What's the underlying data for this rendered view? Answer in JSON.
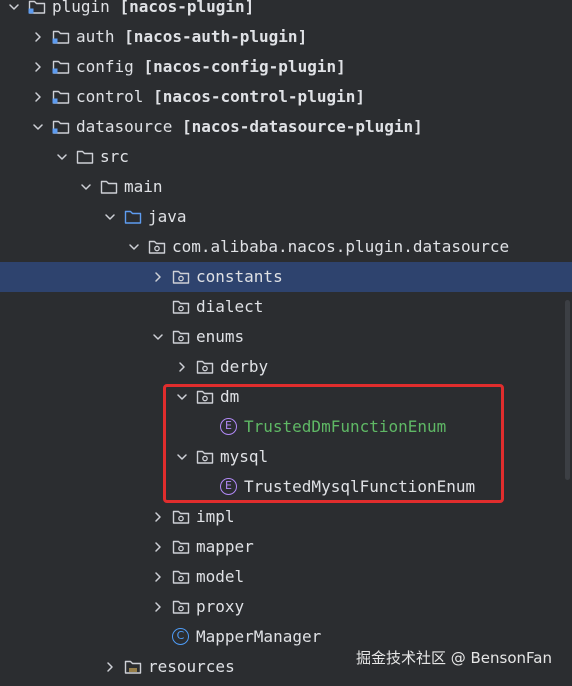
{
  "tree": [
    {
      "label": "plugin [nacos-plugin]",
      "type": "module",
      "expanded": true,
      "depth": 0
    },
    {
      "label": "auth [nacos-auth-plugin]",
      "type": "module",
      "expanded": false,
      "depth": 1
    },
    {
      "label": "config [nacos-config-plugin]",
      "type": "module",
      "expanded": false,
      "depth": 1
    },
    {
      "label": "control [nacos-control-plugin]",
      "type": "module",
      "expanded": false,
      "depth": 1
    },
    {
      "label": "datasource [nacos-datasource-plugin]",
      "type": "module",
      "expanded": true,
      "depth": 1
    },
    {
      "label": "src",
      "type": "folder",
      "expanded": true,
      "depth": 2
    },
    {
      "label": "main",
      "type": "folder",
      "expanded": true,
      "depth": 3
    },
    {
      "label": "java",
      "type": "source-folder",
      "expanded": true,
      "depth": 4
    },
    {
      "label": "com.alibaba.nacos.plugin.datasource",
      "type": "package",
      "expanded": true,
      "depth": 5
    },
    {
      "label": "constants",
      "type": "package",
      "expanded": false,
      "depth": 6,
      "selected": true
    },
    {
      "label": "dialect",
      "type": "package",
      "expanded": null,
      "depth": 6
    },
    {
      "label": "enums",
      "type": "package",
      "expanded": true,
      "depth": 6
    },
    {
      "label": "derby",
      "type": "package",
      "expanded": false,
      "depth": 7
    },
    {
      "label": "dm",
      "type": "package",
      "expanded": true,
      "depth": 7
    },
    {
      "label": "TrustedDmFunctionEnum",
      "type": "enum",
      "expanded": null,
      "depth": 8,
      "color": "green"
    },
    {
      "label": "mysql",
      "type": "package",
      "expanded": true,
      "depth": 7
    },
    {
      "label": "TrustedMysqlFunctionEnum",
      "type": "enum",
      "expanded": null,
      "depth": 8,
      "color": "plain"
    },
    {
      "label": "impl",
      "type": "package",
      "expanded": false,
      "depth": 6
    },
    {
      "label": "mapper",
      "type": "package",
      "expanded": false,
      "depth": 6
    },
    {
      "label": "model",
      "type": "package",
      "expanded": false,
      "depth": 6
    },
    {
      "label": "proxy",
      "type": "package",
      "expanded": false,
      "depth": 6
    },
    {
      "label": "MapperManager",
      "type": "class",
      "expanded": null,
      "depth": 6
    },
    {
      "label": "resources",
      "type": "resources-folder",
      "expanded": false,
      "depth": 4
    }
  ],
  "watermark": "掘金技术社区 @ BensonFan",
  "colors": {
    "background": "#2b2d30",
    "selection": "#2e436e",
    "highlight": "#e02d2d",
    "enum": "#b189f5",
    "class": "#4e9bf5",
    "green_text": "#5fb865"
  }
}
